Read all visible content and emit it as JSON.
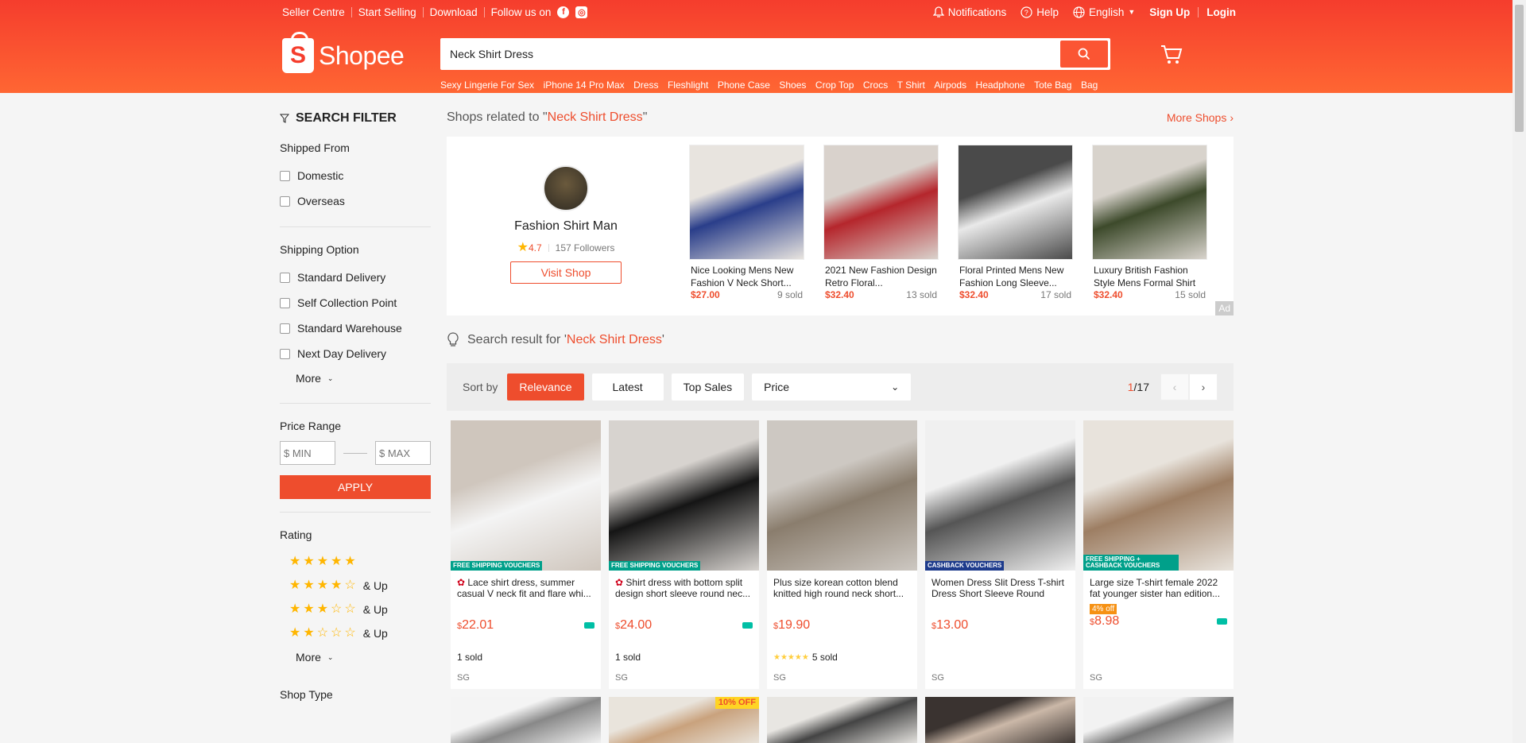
{
  "topbar": {
    "left": [
      "Seller Centre",
      "Start Selling",
      "Download"
    ],
    "follow": "Follow us on",
    "notifications": "Notifications",
    "help": "Help",
    "language": "English",
    "signup": "Sign Up",
    "login": "Login"
  },
  "logo": {
    "text": "Shopee"
  },
  "search": {
    "value": "Neck Shirt Dress"
  },
  "keywords": [
    "Sexy Lingerie For Sex",
    "iPhone 14 Pro Max",
    "Dress",
    "Fleshlight",
    "Phone Case",
    "Shoes",
    "Crop Top",
    "Crocs",
    "T Shirt",
    "Airpods",
    "Headphone",
    "Tote Bag",
    "Bag"
  ],
  "filter": {
    "title": "SEARCH FILTER",
    "shipped_from": {
      "title": "Shipped From",
      "options": [
        "Domestic",
        "Overseas"
      ]
    },
    "shipping_option": {
      "title": "Shipping Option",
      "options": [
        "Standard Delivery",
        "Self Collection Point",
        "Standard Warehouse",
        "Next Day Delivery"
      ],
      "more": "More"
    },
    "price_range": {
      "title": "Price Range",
      "min_placeholder": "$ MIN",
      "max_placeholder": "$ MAX",
      "apply": "APPLY"
    },
    "rating": {
      "title": "Rating",
      "levels": [
        5,
        4,
        3,
        2
      ],
      "and_up": "& Up",
      "more": "More"
    },
    "shop_type": {
      "title": "Shop Type"
    }
  },
  "shops": {
    "prefix": "Shops related to \"",
    "query": "Neck Shirt Dress",
    "suffix": "\"",
    "more": "More Shops",
    "shop": {
      "name": "Fashion Shirt Man",
      "rating": "4.7",
      "followers": "157 Followers",
      "visit": "Visit Shop"
    },
    "products": [
      {
        "name": "Nice Looking Mens New Fashion V Neck Short...",
        "price": "$27.00",
        "sold": "9 sold",
        "colors": [
          "#e8e4df",
          "#2a3e8a"
        ]
      },
      {
        "name": "2021 New Fashion Design Retro Floral...",
        "price": "$32.40",
        "sold": "13 sold",
        "colors": [
          "#d9d2cc",
          "#b5262c"
        ]
      },
      {
        "name": "Floral Printed Mens New Fashion Long Sleeve...",
        "price": "$32.40",
        "sold": "17 sold",
        "colors": [
          "#4a4a4a",
          "#e9e9e9"
        ]
      },
      {
        "name": "Luxury British Fashion Style Mens Formal Shirt",
        "price": "$32.40",
        "sold": "15 sold",
        "colors": [
          "#d8d3cc",
          "#3d4a2b"
        ]
      }
    ],
    "ad": "Ad"
  },
  "result": {
    "prefix": "Search result for '",
    "query": "Neck Shirt Dress",
    "suffix": "'"
  },
  "sort": {
    "label": "Sort by",
    "options": [
      "Relevance",
      "Latest",
      "Top Sales"
    ],
    "price": "Price",
    "page_current": "1",
    "page_total": "/17"
  },
  "products": [
    {
      "name": "Lace shirt dress, summer casual V neck fit and flare whi...",
      "currency": "$",
      "price": "22.01",
      "sold": "1 sold",
      "loc": "SG",
      "badge": "FREE SHIPPING VOUCHERS",
      "colors": [
        "#cfc6bd",
        "#f4f4f4"
      ],
      "mall": true,
      "truck": true
    },
    {
      "name": "Shirt dress with bottom split design short sleeve round nec...",
      "currency": "$",
      "price": "24.00",
      "sold": "1 sold",
      "loc": "SG",
      "badge": "FREE SHIPPING VOUCHERS",
      "colors": [
        "#d7d3cf",
        "#151515"
      ],
      "mall": true,
      "truck": true
    },
    {
      "name": "Plus size korean cotton blend knitted high round neck short...",
      "currency": "$",
      "price": "19.90",
      "sold": "5 sold",
      "stars": "★★★★★",
      "loc": "SG",
      "badge": "",
      "colors": [
        "#cdc8c2",
        "#8a7d6d"
      ],
      "mall": false,
      "truck": false
    },
    {
      "name": "Women Dress Slit Dress T-shirt Dress Short Sleeve Round Nec...",
      "currency": "$",
      "price": "13.00",
      "sold": "",
      "loc": "SG",
      "badge": "CASHBACK VOUCHERS",
      "colors": [
        "#f0f0f0",
        "#555"
      ],
      "mall": false,
      "truck": false
    },
    {
      "name": "Large size T-shirt female 2022 fat younger sister han edition...",
      "currency": "$",
      "price": "8.98",
      "sold": "",
      "loc": "SG",
      "badge": "FREE SHIPPING + CASHBACK VOUCHERS",
      "discount": "4% off",
      "colors": [
        "#e8e3dc",
        "#9d7e63"
      ],
      "mall": false,
      "truck": true
    }
  ],
  "row2": [
    {
      "colors": [
        "#f4f4f4",
        "#888"
      ]
    },
    {
      "colors": [
        "#e9e4dc",
        "#c9a27d"
      ],
      "promo": "10% OFF"
    },
    {
      "colors": [
        "#e8e6e2",
        "#444"
      ]
    },
    {
      "colors": [
        "#3a3330",
        "#cbb8a8"
      ]
    },
    {
      "colors": [
        "#f2f2f2",
        "#777"
      ]
    }
  ]
}
